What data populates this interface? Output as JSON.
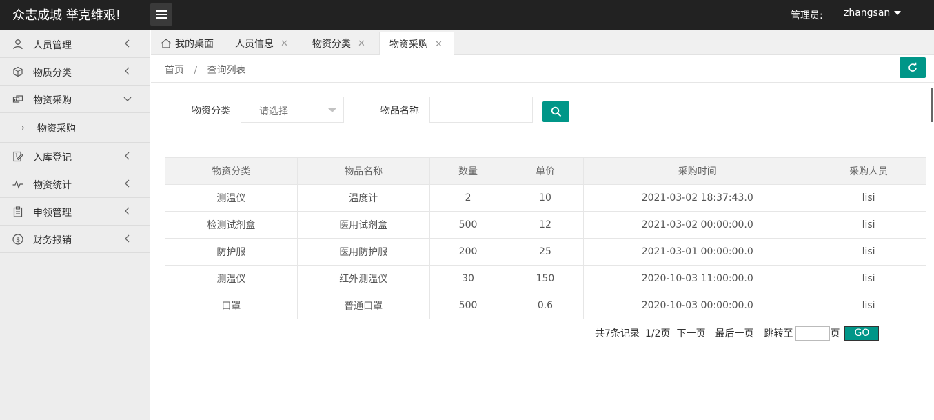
{
  "header": {
    "logo": "众志成城 举克维艰!",
    "admin_label": "管理员:",
    "admin_name": "zhangsan"
  },
  "sidebar": {
    "items": [
      {
        "label": "人员管理",
        "icon": "user-icon",
        "expanded": false
      },
      {
        "label": "物质分类",
        "icon": "cube-icon",
        "expanded": false
      },
      {
        "label": "物资采购",
        "icon": "cart-icon",
        "expanded": true
      },
      {
        "label": "入库登记",
        "icon": "edit-icon",
        "expanded": false
      },
      {
        "label": "物资统计",
        "icon": "pulse-icon",
        "expanded": false
      },
      {
        "label": "申领管理",
        "icon": "clipboard-icon",
        "expanded": false
      },
      {
        "label": "财务报销",
        "icon": "dollar-icon",
        "expanded": false
      }
    ],
    "sub_item": "物资采购"
  },
  "tabs": [
    {
      "label": "我的桌面",
      "closable": false,
      "active": false
    },
    {
      "label": "人员信息",
      "closable": true,
      "active": false
    },
    {
      "label": "物资分类",
      "closable": true,
      "active": false
    },
    {
      "label": "物资采购",
      "closable": true,
      "active": true
    }
  ],
  "breadcrumb": {
    "home": "首页",
    "separator": "/",
    "current": "查询列表"
  },
  "filters": {
    "category_label": "物资分类",
    "category_placeholder": "请选择",
    "name_label": "物品名称",
    "name_value": ""
  },
  "table": {
    "headers": [
      "物资分类",
      "物品名称",
      "数量",
      "单价",
      "采购时间",
      "采购人员"
    ],
    "rows": [
      [
        "测温仪",
        "温度计",
        "2",
        "10",
        "2021-03-02 18:37:43.0",
        "lisi"
      ],
      [
        "检测试剂盒",
        "医用试剂盒",
        "500",
        "12",
        "2021-03-02 00:00:00.0",
        "lisi"
      ],
      [
        "防护服",
        "医用防护服",
        "200",
        "25",
        "2021-03-01 00:00:00.0",
        "lisi"
      ],
      [
        "测温仪",
        "红外测温仪",
        "30",
        "150",
        "2020-10-03 11:00:00.0",
        "lisi"
      ],
      [
        "口罩",
        "普通口罩",
        "500",
        "0.6",
        "2020-10-03 00:00:00.0",
        "lisi"
      ]
    ]
  },
  "pager": {
    "total": "共7条记录",
    "page": "1/2页",
    "next": "下一页",
    "last": "最后一页",
    "jump_to": "跳转至",
    "page_suffix": "页",
    "go": "GO"
  },
  "colors": {
    "accent": "#009688",
    "topbar": "#222222",
    "sidebar": "#ededed"
  }
}
